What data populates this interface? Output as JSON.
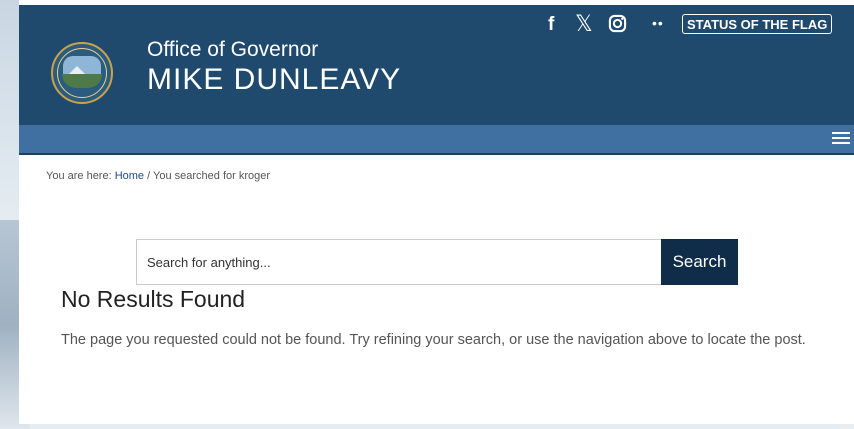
{
  "header": {
    "title_small": "Office of Governor",
    "title_big": "MIKE DUNLEAVY",
    "social": {
      "facebook": "f",
      "x": "𝕏",
      "more": "••"
    },
    "flag_button": "STATUS OF THE FLAG",
    "seal_text": "THE SEAL OF THE STATE OF ALASKA"
  },
  "breadcrumb": {
    "prefix": "You are here: ",
    "home": "Home",
    "separator": " / ",
    "current": "You searched for kroger"
  },
  "search": {
    "placeholder": "Search for anything...",
    "value": "",
    "button": "Search"
  },
  "result": {
    "heading": "No Results Found",
    "message": "The page you requested could not be found. Try refining your search, or use the navigation above to locate the post."
  },
  "colors": {
    "header_bg": "#1f4a6e",
    "nav_bg": "#3f70a1",
    "search_button_bg": "#0f2d48"
  }
}
